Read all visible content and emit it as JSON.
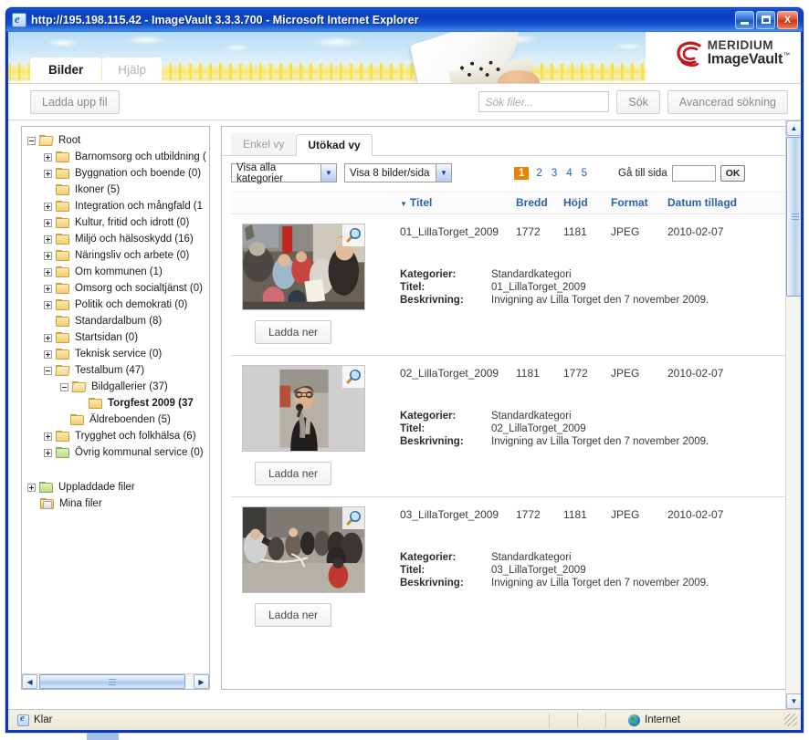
{
  "window": {
    "title": "http://195.198.115.42 - ImageVault 3.3.3.700 - Microsoft Internet Explorer",
    "minimize_label": "Minimize",
    "maximize_label": "Maximize",
    "close_label": "X"
  },
  "header": {
    "logo_brand": "MERIDIUM",
    "logo_product": "ImageVault",
    "logo_tm": "™",
    "tabs": [
      {
        "label": "Bilder",
        "active": true
      },
      {
        "label": "Hjälp",
        "active": false
      }
    ]
  },
  "toolbar": {
    "upload_label": "Ladda upp fil",
    "search_placeholder": "Sök filer...",
    "search_value": "",
    "search_button": "Sök",
    "advanced_button": "Avancerad sökning"
  },
  "tree": {
    "nodes": [
      {
        "label": "Root",
        "depth": 0,
        "expander": "minus",
        "icon": "folder-open",
        "selected": false
      },
      {
        "label": "Barnomsorg och utbildning (",
        "depth": 1,
        "expander": "plus",
        "icon": "folder",
        "selected": false
      },
      {
        "label": "Byggnation och boende (0)",
        "depth": 1,
        "expander": "plus",
        "icon": "folder",
        "selected": false
      },
      {
        "label": "Ikoner (5)",
        "depth": 1,
        "expander": "none",
        "icon": "folder",
        "selected": false
      },
      {
        "label": "Integration och mångfald (1",
        "depth": 1,
        "expander": "plus",
        "icon": "folder",
        "selected": false
      },
      {
        "label": "Kultur, fritid och idrott (0)",
        "depth": 1,
        "expander": "plus",
        "icon": "folder",
        "selected": false
      },
      {
        "label": "Miljö och hälsoskydd (16)",
        "depth": 1,
        "expander": "plus",
        "icon": "folder",
        "selected": false
      },
      {
        "label": "Näringsliv och arbete (0)",
        "depth": 1,
        "expander": "plus",
        "icon": "folder",
        "selected": false
      },
      {
        "label": "Om kommunen (1)",
        "depth": 1,
        "expander": "plus",
        "icon": "folder",
        "selected": false
      },
      {
        "label": "Omsorg och socialtjänst (0)",
        "depth": 1,
        "expander": "plus",
        "icon": "folder",
        "selected": false
      },
      {
        "label": "Politik och demokrati (0)",
        "depth": 1,
        "expander": "plus",
        "icon": "folder",
        "selected": false
      },
      {
        "label": "Standardalbum (8)",
        "depth": 1,
        "expander": "none",
        "icon": "folder",
        "selected": false
      },
      {
        "label": "Startsidan (0)",
        "depth": 1,
        "expander": "plus",
        "icon": "folder",
        "selected": false
      },
      {
        "label": "Teknisk service (0)",
        "depth": 1,
        "expander": "plus",
        "icon": "folder",
        "selected": false
      },
      {
        "label": "Testalbum (47)",
        "depth": 1,
        "expander": "minus",
        "icon": "folder-open",
        "selected": false
      },
      {
        "label": "Bildgallerier (37)",
        "depth": 2,
        "expander": "minus",
        "icon": "folder-open",
        "selected": false
      },
      {
        "label": "Torgfest 2009 (37",
        "depth": 3,
        "expander": "none",
        "icon": "folder",
        "selected": true
      },
      {
        "label": "Äldreboenden (5)",
        "depth": 2,
        "expander": "none",
        "icon": "folder",
        "selected": false
      },
      {
        "label": "Trygghet och folkhälsa (6)",
        "depth": 1,
        "expander": "plus",
        "icon": "folder",
        "selected": false
      },
      {
        "label": "Övrig kommunal service (0)",
        "depth": 1,
        "expander": "plus",
        "icon": "folder",
        "selected": false
      }
    ],
    "extra_nodes": [
      {
        "label": "Uppladdade filer",
        "depth": 0,
        "expander": "plus",
        "icon": "folder-green",
        "selected": false
      },
      {
        "label": "Mina filer",
        "depth": 0,
        "expander": "none",
        "icon": "folder-myfiles",
        "selected": false
      }
    ]
  },
  "content": {
    "view_tabs": [
      {
        "label": "Enkel vy",
        "active": false
      },
      {
        "label": "Utökad vy",
        "active": true
      }
    ],
    "category_filter": "Visa alla kategorier",
    "perpage_filter": "Visa 8 bilder/sida",
    "pages": [
      "1",
      "2",
      "3",
      "4",
      "5"
    ],
    "active_page": "1",
    "goto_label": "Gå till sida",
    "goto_value": "",
    "ok_label": "OK",
    "columns": {
      "thumb": "",
      "titel": "Titel",
      "bredd": "Bredd",
      "hojd": "Höjd",
      "format": "Format",
      "datum": "Datum tillagd"
    },
    "sort_caret": "▼",
    "labels": {
      "kategorier": "Kategorier:",
      "titel": "Titel:",
      "beskrivning": "Beskrivning:",
      "download": "Ladda ner"
    },
    "rows": [
      {
        "titel": "01_LillaTorget_2009",
        "bredd": "1772",
        "hojd": "1181",
        "format": "JPEG",
        "datum": "2010-02-07",
        "kategorier": "Standardkategori",
        "titel_detail": "01_LillaTorget_2009",
        "beskrivning": "Invigning av Lilla Torget den 7 november 2009.",
        "orientation": "landscape",
        "download": "Ladda ner"
      },
      {
        "titel": "02_LillaTorget_2009",
        "bredd": "1181",
        "hojd": "1772",
        "format": "JPEG",
        "datum": "2010-02-07",
        "kategorier": "Standardkategori",
        "titel_detail": "02_LillaTorget_2009",
        "beskrivning": "Invigning av Lilla Torget den 7 november 2009.",
        "orientation": "portrait",
        "download": "Ladda ner"
      },
      {
        "titel": "03_LillaTorget_2009",
        "bredd": "1772",
        "hojd": "1181",
        "format": "JPEG",
        "datum": "2010-02-07",
        "kategorier": "Standardkategori",
        "titel_detail": "03_LillaTorget_2009",
        "beskrivning": "Invigning av Lilla Torget den 7 november 2009.",
        "orientation": "landscape",
        "download": "Ladda ner"
      }
    ]
  },
  "statusbar": {
    "status": "Klar",
    "zone": "Internet"
  },
  "colors": {
    "accent_orange": "#f08000",
    "link_blue": "#2060c0",
    "header_blue": "#2a63ad",
    "titlebar_blue": "#0a3ec4"
  }
}
